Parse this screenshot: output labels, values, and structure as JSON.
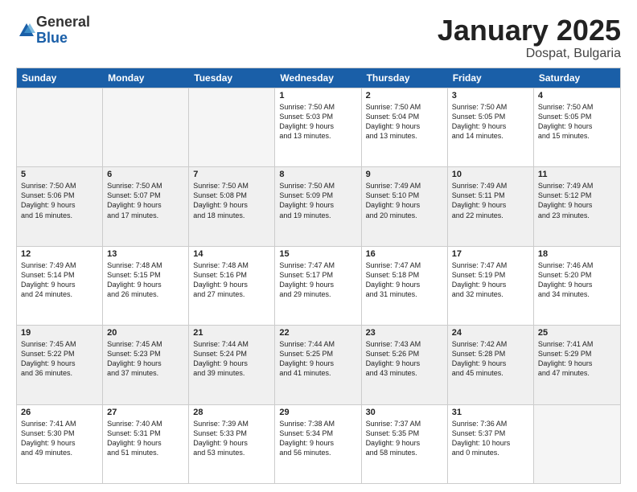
{
  "logo": {
    "general": "General",
    "blue": "Blue"
  },
  "title": {
    "month": "January 2025",
    "location": "Dospat, Bulgaria"
  },
  "header_days": [
    "Sunday",
    "Monday",
    "Tuesday",
    "Wednesday",
    "Thursday",
    "Friday",
    "Saturday"
  ],
  "rows": [
    [
      {
        "day": "",
        "text": "",
        "empty": true
      },
      {
        "day": "",
        "text": "",
        "empty": true
      },
      {
        "day": "",
        "text": "",
        "empty": true
      },
      {
        "day": "1",
        "text": "Sunrise: 7:50 AM\nSunset: 5:03 PM\nDaylight: 9 hours\nand 13 minutes."
      },
      {
        "day": "2",
        "text": "Sunrise: 7:50 AM\nSunset: 5:04 PM\nDaylight: 9 hours\nand 13 minutes."
      },
      {
        "day": "3",
        "text": "Sunrise: 7:50 AM\nSunset: 5:05 PM\nDaylight: 9 hours\nand 14 minutes."
      },
      {
        "day": "4",
        "text": "Sunrise: 7:50 AM\nSunset: 5:05 PM\nDaylight: 9 hours\nand 15 minutes."
      }
    ],
    [
      {
        "day": "5",
        "text": "Sunrise: 7:50 AM\nSunset: 5:06 PM\nDaylight: 9 hours\nand 16 minutes.",
        "shaded": true
      },
      {
        "day": "6",
        "text": "Sunrise: 7:50 AM\nSunset: 5:07 PM\nDaylight: 9 hours\nand 17 minutes.",
        "shaded": true
      },
      {
        "day": "7",
        "text": "Sunrise: 7:50 AM\nSunset: 5:08 PM\nDaylight: 9 hours\nand 18 minutes.",
        "shaded": true
      },
      {
        "day": "8",
        "text": "Sunrise: 7:50 AM\nSunset: 5:09 PM\nDaylight: 9 hours\nand 19 minutes.",
        "shaded": true
      },
      {
        "day": "9",
        "text": "Sunrise: 7:49 AM\nSunset: 5:10 PM\nDaylight: 9 hours\nand 20 minutes.",
        "shaded": true
      },
      {
        "day": "10",
        "text": "Sunrise: 7:49 AM\nSunset: 5:11 PM\nDaylight: 9 hours\nand 22 minutes.",
        "shaded": true
      },
      {
        "day": "11",
        "text": "Sunrise: 7:49 AM\nSunset: 5:12 PM\nDaylight: 9 hours\nand 23 minutes.",
        "shaded": true
      }
    ],
    [
      {
        "day": "12",
        "text": "Sunrise: 7:49 AM\nSunset: 5:14 PM\nDaylight: 9 hours\nand 24 minutes."
      },
      {
        "day": "13",
        "text": "Sunrise: 7:48 AM\nSunset: 5:15 PM\nDaylight: 9 hours\nand 26 minutes."
      },
      {
        "day": "14",
        "text": "Sunrise: 7:48 AM\nSunset: 5:16 PM\nDaylight: 9 hours\nand 27 minutes."
      },
      {
        "day": "15",
        "text": "Sunrise: 7:47 AM\nSunset: 5:17 PM\nDaylight: 9 hours\nand 29 minutes."
      },
      {
        "day": "16",
        "text": "Sunrise: 7:47 AM\nSunset: 5:18 PM\nDaylight: 9 hours\nand 31 minutes."
      },
      {
        "day": "17",
        "text": "Sunrise: 7:47 AM\nSunset: 5:19 PM\nDaylight: 9 hours\nand 32 minutes."
      },
      {
        "day": "18",
        "text": "Sunrise: 7:46 AM\nSunset: 5:20 PM\nDaylight: 9 hours\nand 34 minutes."
      }
    ],
    [
      {
        "day": "19",
        "text": "Sunrise: 7:45 AM\nSunset: 5:22 PM\nDaylight: 9 hours\nand 36 minutes.",
        "shaded": true
      },
      {
        "day": "20",
        "text": "Sunrise: 7:45 AM\nSunset: 5:23 PM\nDaylight: 9 hours\nand 37 minutes.",
        "shaded": true
      },
      {
        "day": "21",
        "text": "Sunrise: 7:44 AM\nSunset: 5:24 PM\nDaylight: 9 hours\nand 39 minutes.",
        "shaded": true
      },
      {
        "day": "22",
        "text": "Sunrise: 7:44 AM\nSunset: 5:25 PM\nDaylight: 9 hours\nand 41 minutes.",
        "shaded": true
      },
      {
        "day": "23",
        "text": "Sunrise: 7:43 AM\nSunset: 5:26 PM\nDaylight: 9 hours\nand 43 minutes.",
        "shaded": true
      },
      {
        "day": "24",
        "text": "Sunrise: 7:42 AM\nSunset: 5:28 PM\nDaylight: 9 hours\nand 45 minutes.",
        "shaded": true
      },
      {
        "day": "25",
        "text": "Sunrise: 7:41 AM\nSunset: 5:29 PM\nDaylight: 9 hours\nand 47 minutes.",
        "shaded": true
      }
    ],
    [
      {
        "day": "26",
        "text": "Sunrise: 7:41 AM\nSunset: 5:30 PM\nDaylight: 9 hours\nand 49 minutes."
      },
      {
        "day": "27",
        "text": "Sunrise: 7:40 AM\nSunset: 5:31 PM\nDaylight: 9 hours\nand 51 minutes."
      },
      {
        "day": "28",
        "text": "Sunrise: 7:39 AM\nSunset: 5:33 PM\nDaylight: 9 hours\nand 53 minutes."
      },
      {
        "day": "29",
        "text": "Sunrise: 7:38 AM\nSunset: 5:34 PM\nDaylight: 9 hours\nand 56 minutes."
      },
      {
        "day": "30",
        "text": "Sunrise: 7:37 AM\nSunset: 5:35 PM\nDaylight: 9 hours\nand 58 minutes."
      },
      {
        "day": "31",
        "text": "Sunrise: 7:36 AM\nSunset: 5:37 PM\nDaylight: 10 hours\nand 0 minutes."
      },
      {
        "day": "",
        "text": "",
        "empty": true
      }
    ]
  ]
}
